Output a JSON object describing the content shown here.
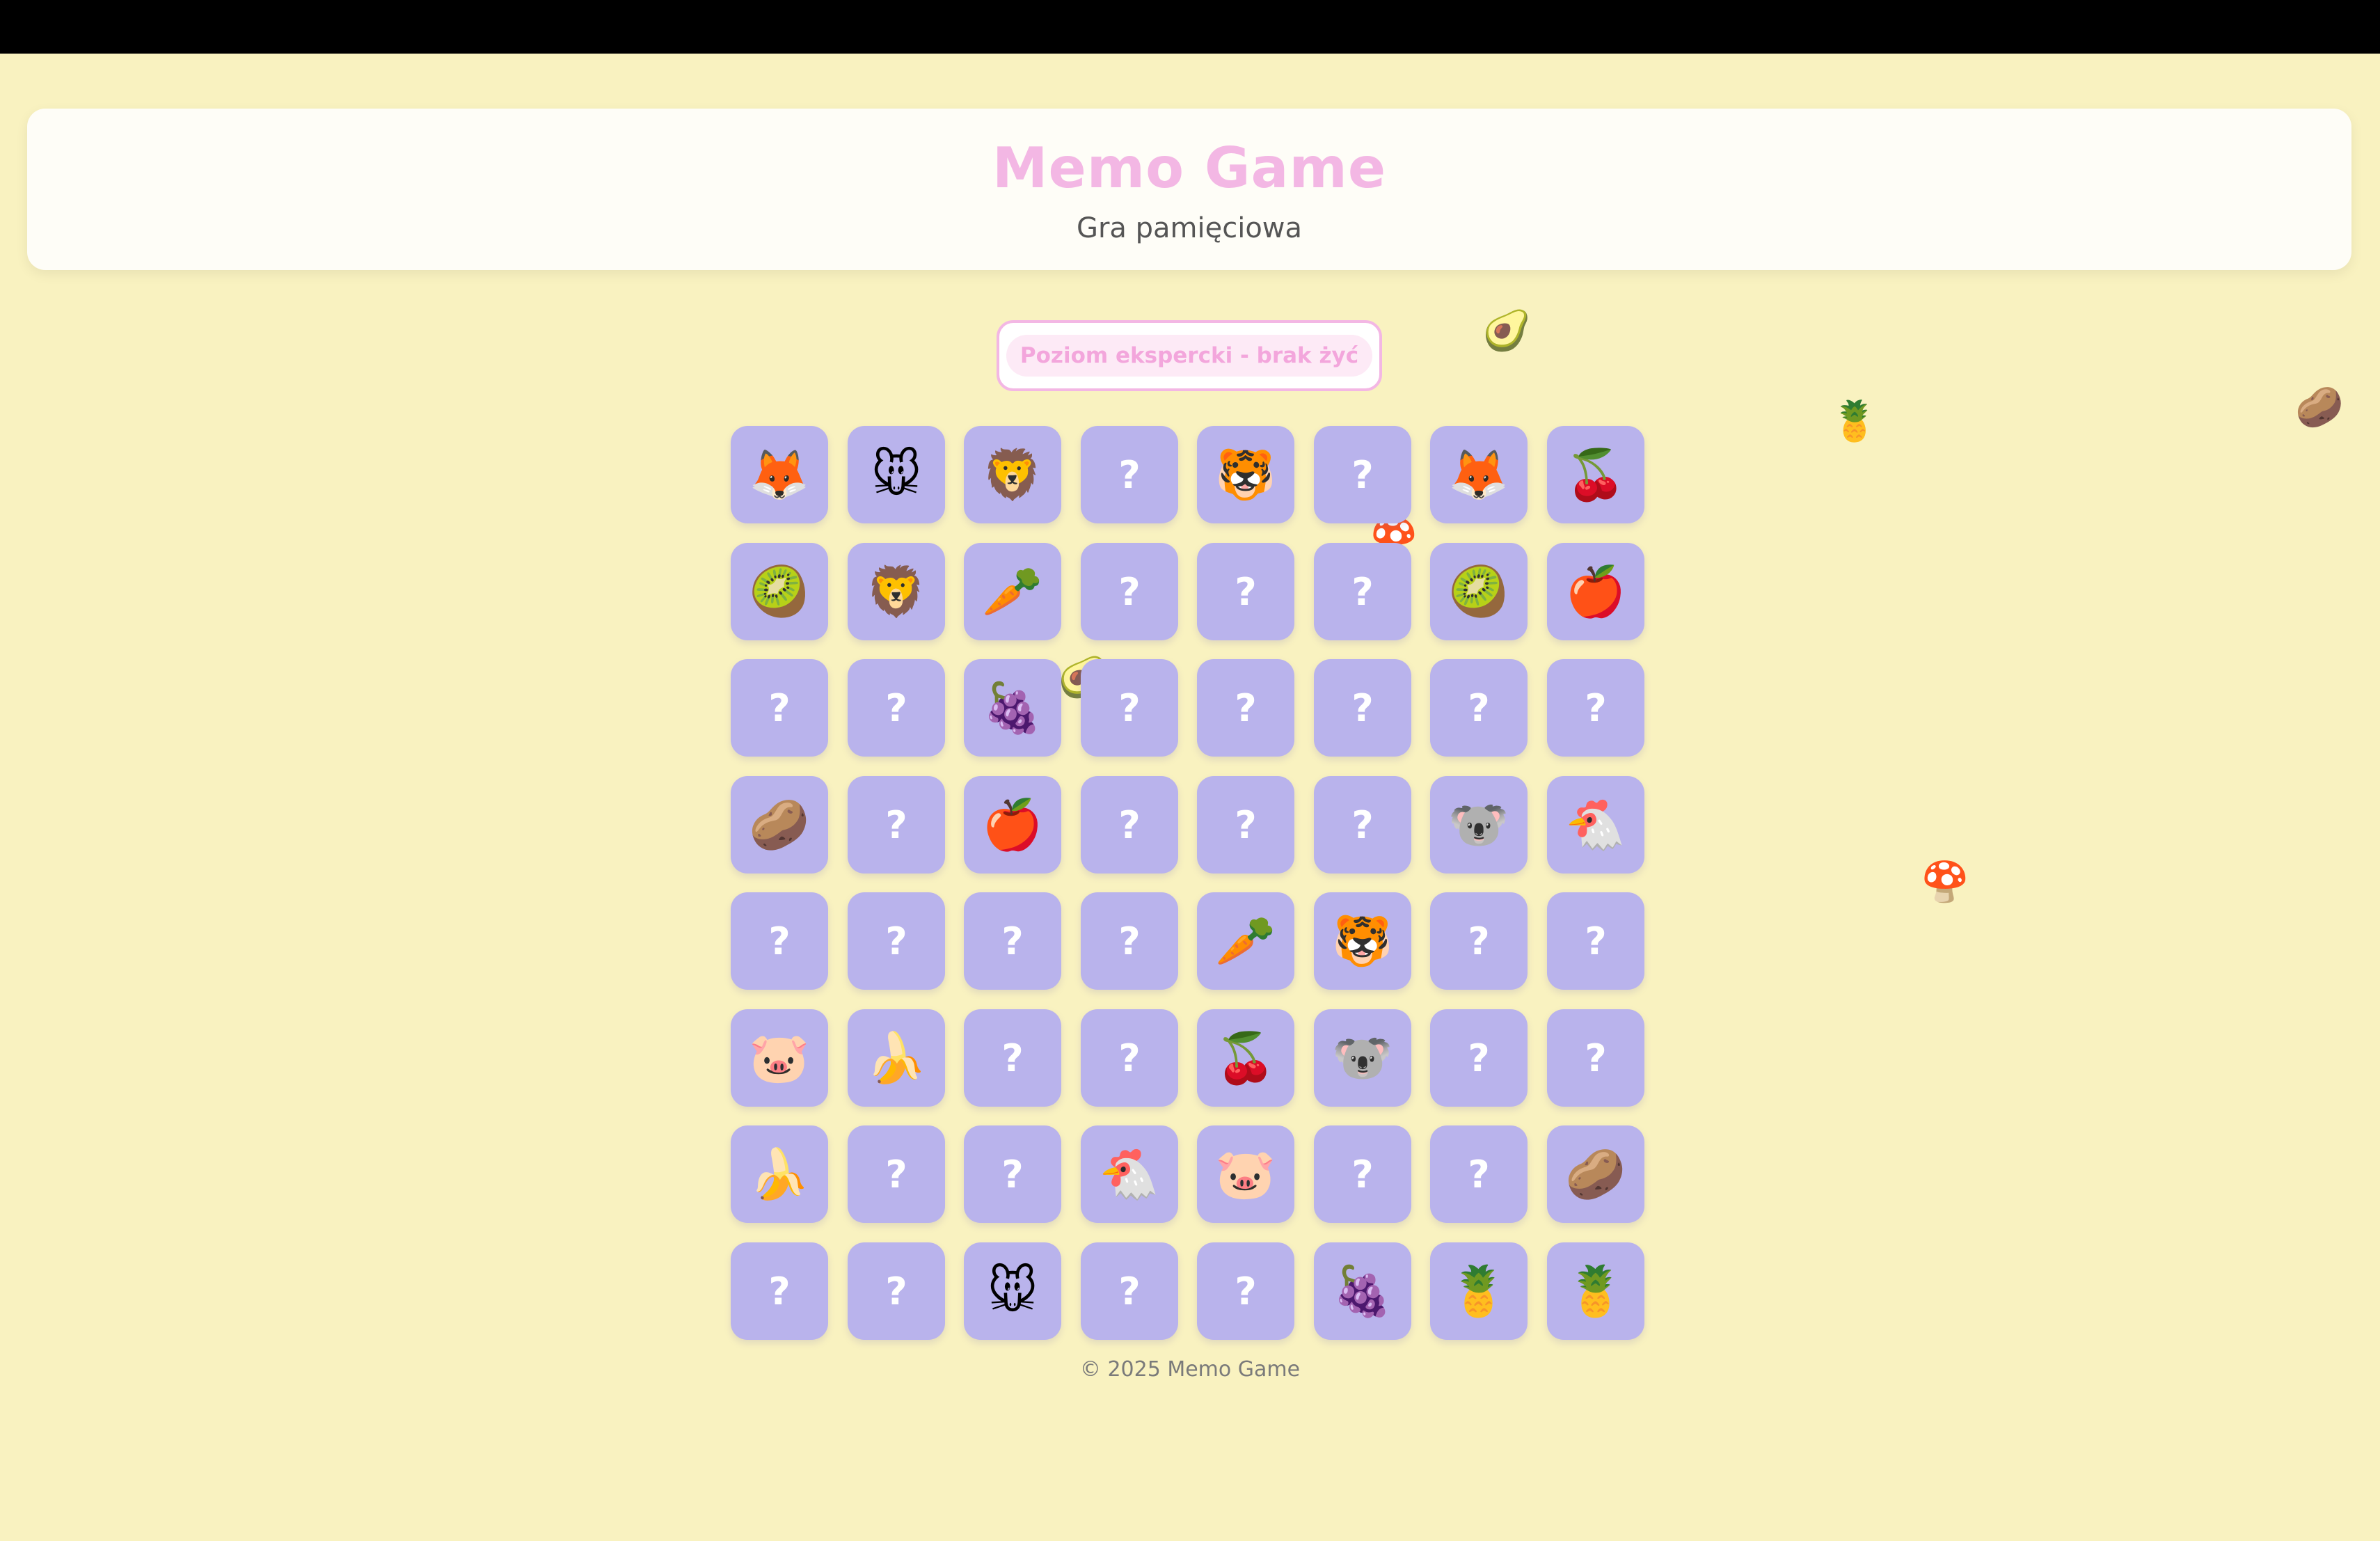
{
  "header": {
    "title": "Memo Game",
    "subtitle": "Gra pamięciowa"
  },
  "status": {
    "level_label": "Poziom ekspercki - brak żyć"
  },
  "board": {
    "rows": 8,
    "cols": 8,
    "hidden_symbol": "?",
    "cards": [
      [
        "fox",
        "mouse",
        "lion",
        null,
        "tiger",
        null,
        "fox",
        "cherry"
      ],
      [
        "kiwi",
        "lion",
        "carrot",
        null,
        null,
        null,
        "kiwi",
        "apple"
      ],
      [
        null,
        null,
        "grapes",
        null,
        null,
        null,
        null,
        null
      ],
      [
        "potato",
        null,
        "apple",
        null,
        null,
        null,
        "koala",
        "chicken"
      ],
      [
        null,
        null,
        null,
        null,
        "carrot",
        "tiger",
        null,
        null
      ],
      [
        "pig",
        "banana",
        null,
        null,
        "cherry",
        "koala",
        null,
        null
      ],
      [
        "banana",
        null,
        null,
        "chicken",
        "pig",
        null,
        null,
        "potato"
      ],
      [
        null,
        null,
        "mouse",
        null,
        null,
        "grapes",
        "pineapple",
        "pineapple"
      ]
    ]
  },
  "icons": {
    "fox": "🦊",
    "mouse": "🐭",
    "lion": "🦁",
    "tiger": "🐯",
    "cherry": "🍒",
    "kiwi": "🥝",
    "carrot": "🥕",
    "apple": "🍎",
    "grapes": "🍇",
    "potato": "🥔",
    "koala": "🐨",
    "chicken": "🐔",
    "pig": "🐷",
    "banana": "🍌",
    "pineapple": "🍍",
    "avocado": "🥑",
    "mushroom": "🍄"
  },
  "decorations": [
    "avocado",
    "pineapple",
    "potato",
    "mushroom",
    "mushroom",
    "avocado"
  ],
  "footer": {
    "text": "© 2025 Memo Game"
  },
  "colors": {
    "background": "#f9f2c0",
    "card": "#b9b3ec",
    "accent_pink": "#f3b7e4"
  }
}
